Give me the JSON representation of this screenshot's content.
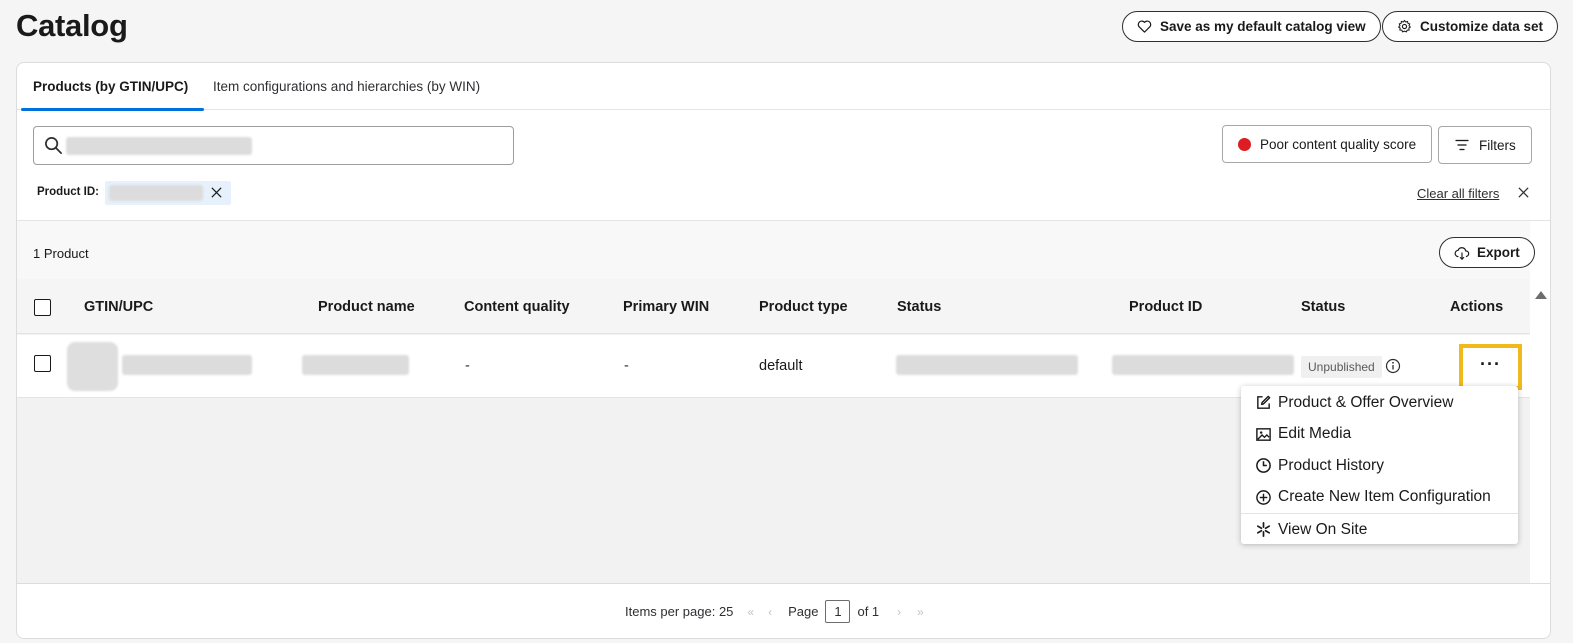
{
  "page": {
    "title": "Catalog"
  },
  "header_actions": {
    "save_default_label": "Save as my default catalog view",
    "customize_label": "Customize data set"
  },
  "tabs": [
    {
      "label": "Products (by GTIN/UPC)",
      "active": true
    },
    {
      "label": "Item configurations and hierarchies (by WIN)",
      "active": false
    }
  ],
  "search": {
    "value": "",
    "placeholder": ""
  },
  "toolbar": {
    "quality_filter_label": "Poor content quality score",
    "filters_label": "Filters",
    "quality_dot_color": "#de1c24"
  },
  "active_filters": {
    "label": "Product ID:",
    "clear_all_label": "Clear all filters"
  },
  "results": {
    "count_label": "1 Product",
    "export_label": "Export"
  },
  "table": {
    "columns": [
      "GTIN/UPC",
      "Product name",
      "Content quality",
      "Primary WIN",
      "Product type",
      "Status",
      "Product ID",
      "Status",
      "Actions"
    ],
    "rows": [
      {
        "content_quality": "-",
        "primary_win": "-",
        "product_type": "default",
        "status_badge": "Unpublished",
        "actions_label": "···"
      }
    ]
  },
  "actions_menu": {
    "items": [
      {
        "label": "Product & Offer Overview",
        "icon": "edit-icon"
      },
      {
        "label": "Edit Media",
        "icon": "image-icon"
      },
      {
        "label": "Product History",
        "icon": "clock-icon"
      },
      {
        "label": "Create New Item Configuration",
        "icon": "plus-circle-icon"
      },
      {
        "label": "View On Site",
        "icon": "spark-icon"
      }
    ]
  },
  "pagination": {
    "items_per_page_label": "Items per page: 25",
    "page_label": "Page",
    "current_page": "1",
    "of_label": "of 1"
  },
  "colors": {
    "accent": "#0071dc",
    "highlight": "#f2b91c",
    "filter_chip_bg": "#e6f1fc"
  }
}
